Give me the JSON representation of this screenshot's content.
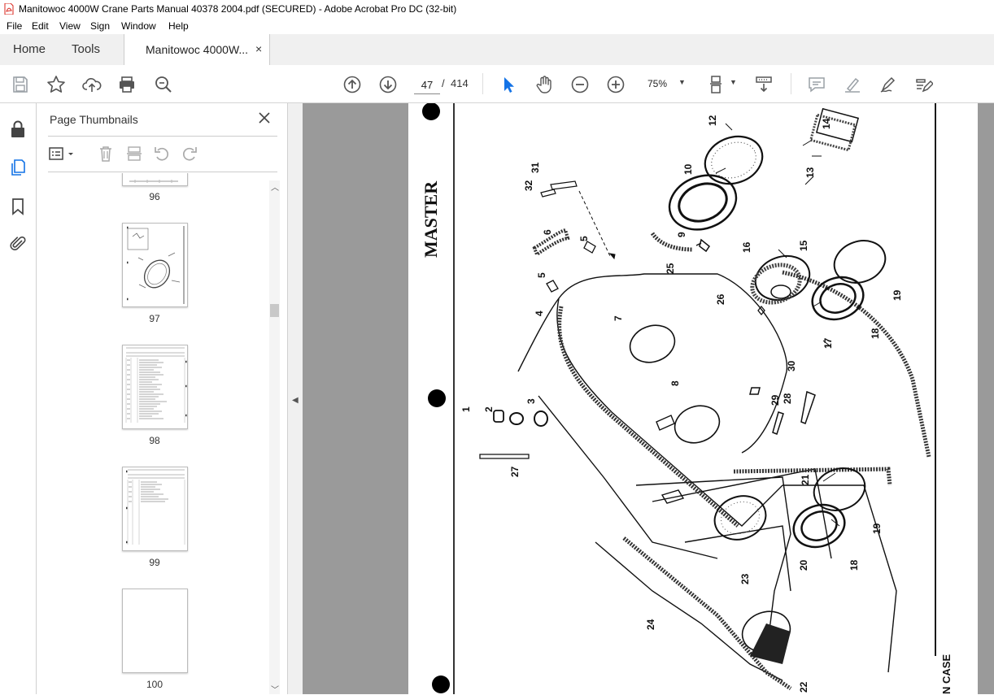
{
  "window": {
    "title": "Manitowoc 4000W Crane Parts Manual 40378 2004.pdf (SECURED) - Adobe Acrobat Pro DC (32-bit)"
  },
  "menu": [
    "File",
    "Edit",
    "View",
    "Sign",
    "Window",
    "Help"
  ],
  "tabs": {
    "home": "Home",
    "tools": "Tools",
    "document": "Manitowoc 4000W...",
    "close": "×"
  },
  "toolbar": {
    "page_current": "47",
    "page_separator": "/",
    "page_total": "414",
    "zoom": "75%",
    "icons": [
      "save-icon",
      "bookmark-star-icon",
      "upload-icon",
      "print-icon",
      "find-icon",
      "page-up-icon",
      "page-down-icon",
      "select-cursor-icon",
      "hand-icon",
      "zoom-out-icon",
      "zoom-in-icon",
      "zoom-dropdown-icon",
      "page-layout-icon",
      "scroll-mode-icon",
      "comment-icon",
      "highlight-icon",
      "fill-sign-icon",
      "edit-icon"
    ]
  },
  "sidebar": {
    "title": "Page Thumbnails",
    "close": "×",
    "rail_icons": [
      "lock-icon",
      "page-thumbnails-icon",
      "bookmark-icon",
      "attachment-icon"
    ],
    "thumbnails": [
      {
        "label": "96"
      },
      {
        "label": "97"
      },
      {
        "label": "98"
      },
      {
        "label": "99"
      },
      {
        "label": "100"
      }
    ]
  },
  "document": {
    "labels": [
      "MASTER",
      "1",
      "2",
      "3",
      "4",
      "5",
      "5",
      "6",
      "7",
      "8",
      "9",
      "10",
      "12",
      "13",
      "14",
      "15",
      "16",
      "17",
      "18",
      "18",
      "19",
      "19",
      "20",
      "21",
      "22",
      "23",
      "24",
      "25",
      "26",
      "27",
      "28",
      "29",
      "30",
      "31",
      "32",
      "N CASE"
    ]
  },
  "colors": {
    "accent": "#1473e6",
    "tab_bg": "#f0f0f0",
    "doc_bg": "#9a9a9a",
    "pdf_red": "#d9241b"
  }
}
